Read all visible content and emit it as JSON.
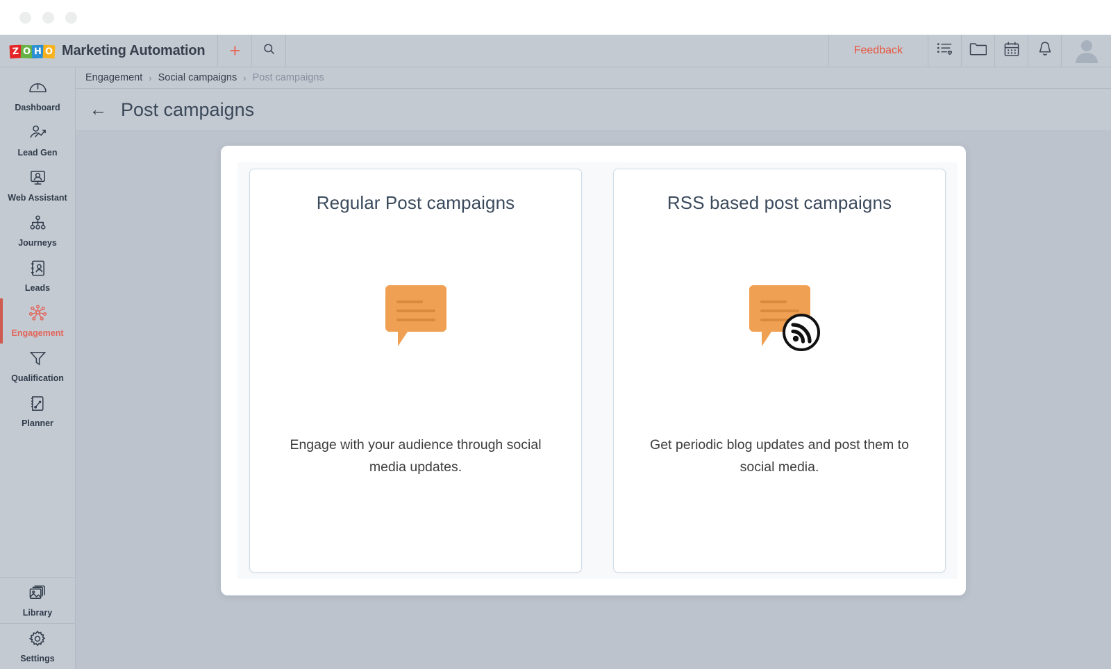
{
  "window": {
    "dots": [
      "minimize-dot",
      "maximize-dot",
      "close-dot"
    ]
  },
  "topbar": {
    "logo_letters": [
      "Z",
      "O",
      "H",
      "O"
    ],
    "logo_colors": [
      "#e42527",
      "#66b245",
      "#2a8fd4",
      "#f9b21d"
    ],
    "app_title": "Marketing Automation",
    "add_label": "+",
    "search_icon": "search-icon",
    "feedback_label": "Feedback",
    "icons": [
      {
        "name": "list-heart-icon"
      },
      {
        "name": "folder-icon"
      },
      {
        "name": "calendar-icon"
      },
      {
        "name": "bell-icon"
      }
    ],
    "avatar": "user-avatar"
  },
  "sidebar": {
    "items": [
      {
        "label": "Dashboard",
        "icon": "dashboard-icon",
        "active": false
      },
      {
        "label": "Lead Gen",
        "icon": "lead-gen-icon",
        "active": false
      },
      {
        "label": "Web Assistant",
        "icon": "web-assistant-icon",
        "active": false
      },
      {
        "label": "Journeys",
        "icon": "journeys-icon",
        "active": false
      },
      {
        "label": "Leads",
        "icon": "leads-icon",
        "active": false
      },
      {
        "label": "Engagement",
        "icon": "engagement-icon",
        "active": true
      },
      {
        "label": "Qualification",
        "icon": "qualification-icon",
        "active": false
      },
      {
        "label": "Planner",
        "icon": "planner-icon",
        "active": false
      }
    ],
    "bottom_items": [
      {
        "label": "Library",
        "icon": "library-icon"
      },
      {
        "label": "Settings",
        "icon": "settings-gear-icon"
      }
    ],
    "active_color": "#e2655a"
  },
  "breadcrumb": {
    "items": [
      {
        "label": "Engagement",
        "muted": false
      },
      {
        "label": "Social campaigns",
        "muted": false
      },
      {
        "label": "Post campaigns",
        "muted": true
      }
    ],
    "separator": "›"
  },
  "page": {
    "back_arrow": "←",
    "title": "Post campaigns"
  },
  "cards": [
    {
      "title": "Regular Post campaigns",
      "description": "Engage with your audience through social media updates.",
      "icon": "speech-bubble-icon",
      "icon_color": "#f0a052"
    },
    {
      "title": "RSS based post campaigns",
      "description": "Get periodic blog updates and post them to social media.",
      "icon": "speech-bubble-rss-icon",
      "icon_color": "#f0a052"
    }
  ],
  "theme": {
    "accent": "#e8563f",
    "chrome_bg": "#c4cad2",
    "stage_bg": "#bcc3cc",
    "panel_bg": "#ffffff",
    "card_border": "#cfdce6",
    "title_color": "#3b4a5c"
  }
}
